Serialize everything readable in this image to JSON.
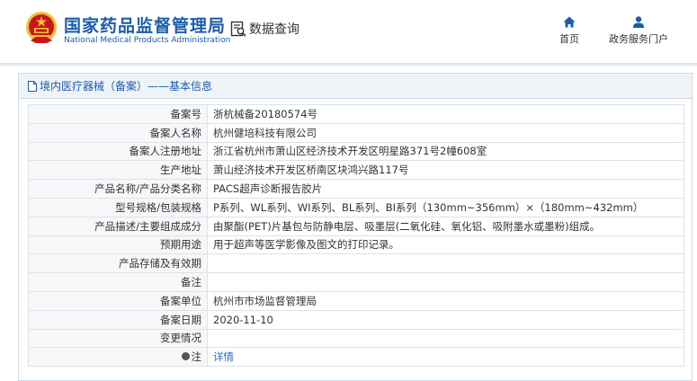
{
  "header": {
    "brand_cn": "国家药品监督管理局",
    "brand_en": "National Medical Products Administration",
    "query_label": "数据查询",
    "nav": {
      "home": "首页",
      "service": "政务服务门户"
    },
    "colors": {
      "brand": "#1c5cab",
      "emblem_red": "#c8161d",
      "emblem_gold": "#f2c230"
    }
  },
  "panel": {
    "title": "境内医疗器械（备案）——基本信息"
  },
  "rows": [
    {
      "label": "备案号",
      "value": "浙杭械备20180574号"
    },
    {
      "label": "备案人名称",
      "value": "杭州健培科技有限公司"
    },
    {
      "label": "备案人注册地址",
      "value": "浙江省杭州市萧山区经济技术开发区明星路371号2幢608室"
    },
    {
      "label": "生产地址",
      "value": "萧山经济技术开发区桥南区块鸿兴路117号"
    },
    {
      "label": "产品名称/产品分类名称",
      "value": "PACS超声诊断报告胶片"
    },
    {
      "label": "型号规格/包装规格",
      "value": "P系列、WL系列、WI系列、BL系列、BI系列（130mm~356mm）×（180mm~432mm）"
    },
    {
      "label": "产品描述/主要组成成分",
      "value": "由聚酯(PET)片基包与防静电层、吸墨层(二氧化硅、氧化铝、吸附墨水或墨粉)组成。"
    },
    {
      "label": "预期用途",
      "value": "用于超声等医学影像及图文的打印记录。"
    },
    {
      "label": "产品存储及有效期",
      "value": ""
    },
    {
      "label": "备注",
      "value": ""
    },
    {
      "label": "备案单位",
      "value": "杭州市市场监督管理局"
    },
    {
      "label": "备案日期",
      "value": "2020-11-10"
    },
    {
      "label": "变更情况",
      "value": ""
    },
    {
      "label": "注",
      "value": "详情"
    }
  ]
}
